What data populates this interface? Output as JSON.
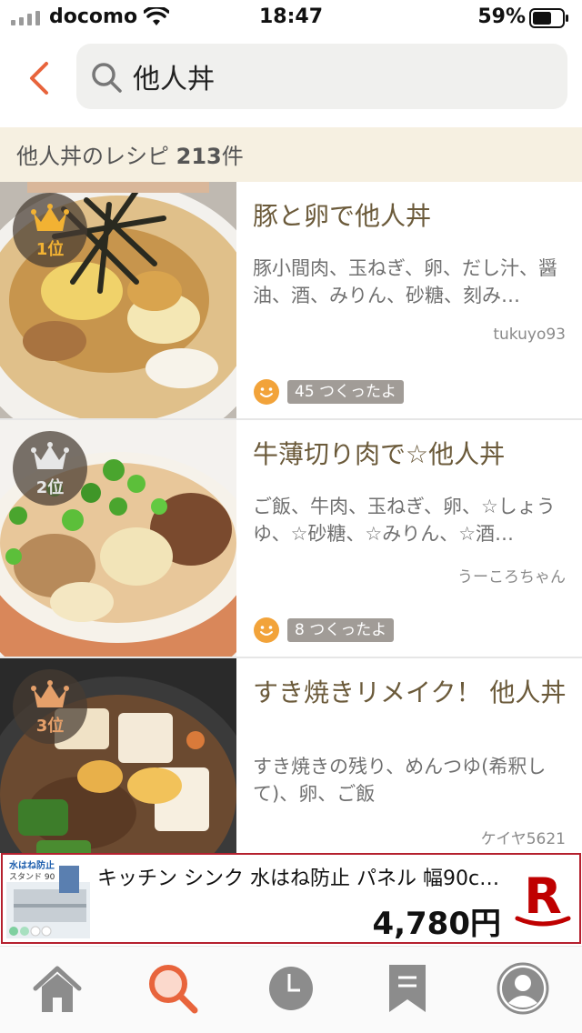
{
  "status_bar": {
    "carrier": "docomo",
    "time": "18:47",
    "battery_percent": "59%"
  },
  "search": {
    "query": "他人丼"
  },
  "results": {
    "prefix": "他人丼のレシピ",
    "count": "213",
    "suffix": "件"
  },
  "recipes": [
    {
      "rank_label": "1位",
      "rank_color": "#f2b233",
      "title": "豚と卵で他人丼",
      "ingredients": "豚小間肉、玉ねぎ、卵、だし汁、醤油、酒、みりん、砂糖、刻み…",
      "author": "tukuyo93",
      "made_count": "45 つくったよ"
    },
    {
      "rank_label": "2位",
      "rank_color": "#e6e6e6",
      "title": "牛薄切り肉で☆他人丼",
      "ingredients": "ご飯、牛肉、玉ねぎ、卵、☆しょうゆ、☆砂糖、☆みりん、☆酒…",
      "author": "うーころちゃん",
      "made_count": "8 つくったよ"
    },
    {
      "rank_label": "3位",
      "rank_color": "#e5a06a",
      "title": "すき焼きリメイク！ 他人丼",
      "ingredients": "すき焼きの残り、めんつゆ(希釈して)、卵、ご飯",
      "author": "ケイヤ5621"
    }
  ],
  "ad": {
    "thumb_caption_line1": "水はね防止",
    "thumb_caption_line2": "スタンド 90",
    "title": "キッチン シンク 水はね防止 パネル 幅90c…",
    "price": "4,780円",
    "logo_letter": "R"
  },
  "colors": {
    "accent": "#e8643c",
    "tab_gray": "#8c8c8c",
    "rakuten_red": "#bf0000"
  },
  "tabs": [
    "home-icon",
    "search-icon",
    "history-icon",
    "bookmark-icon",
    "profile-icon"
  ]
}
